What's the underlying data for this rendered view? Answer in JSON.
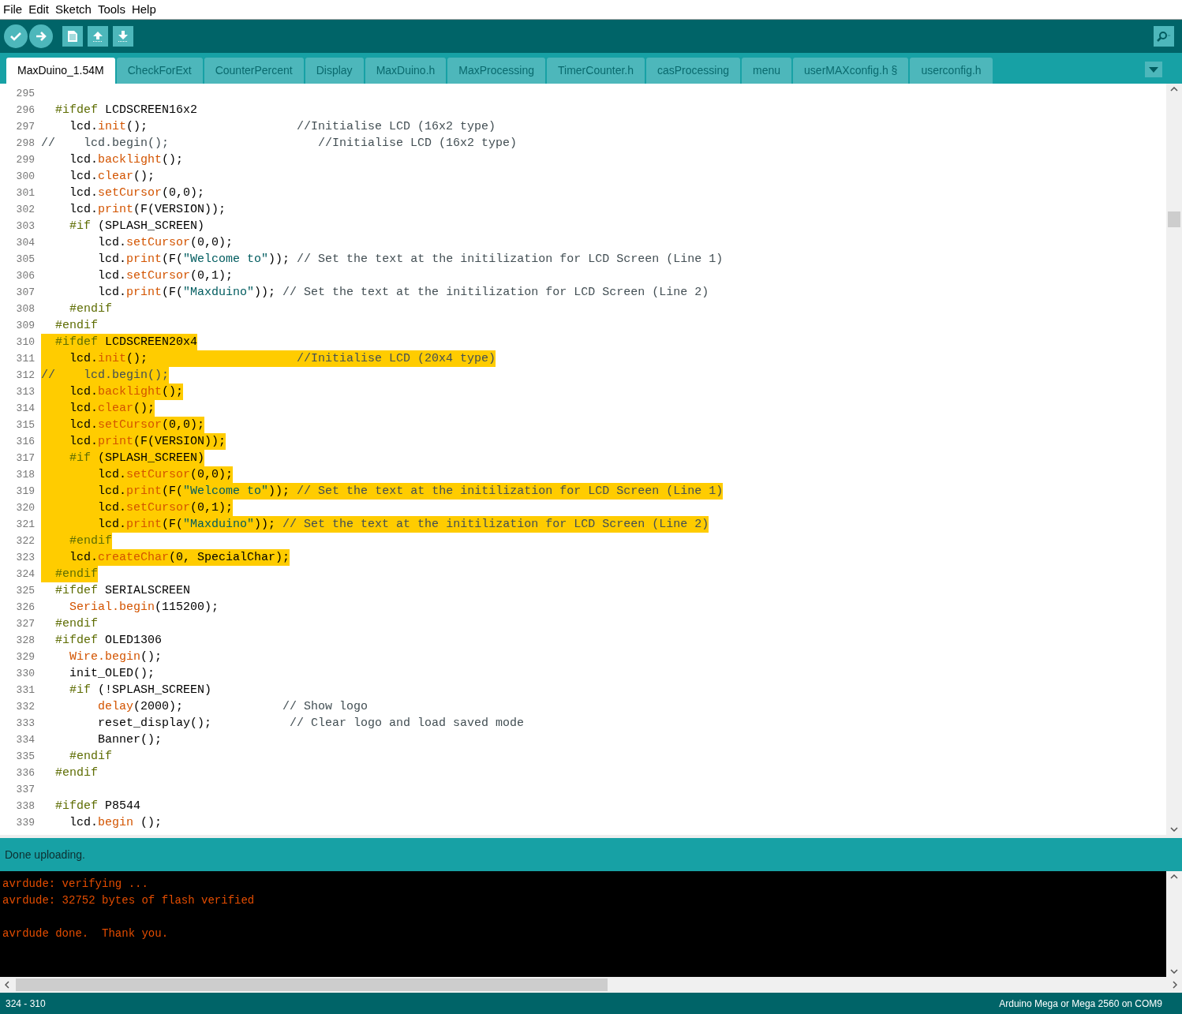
{
  "menu": [
    "File",
    "Edit",
    "Sketch",
    "Tools",
    "Help"
  ],
  "tabs": [
    {
      "label": "MaxDuino_1.54M",
      "selected": true
    },
    {
      "label": "CheckForExt",
      "selected": false
    },
    {
      "label": "CounterPercent",
      "selected": false
    },
    {
      "label": "Display",
      "selected": false
    },
    {
      "label": "MaxDuino.h",
      "selected": false
    },
    {
      "label": "MaxProcessing",
      "selected": false
    },
    {
      "label": "TimerCounter.h",
      "selected": false
    },
    {
      "label": "casProcessing",
      "selected": false
    },
    {
      "label": "menu",
      "selected": false
    },
    {
      "label": "userMAXconfig.h §",
      "selected": false
    },
    {
      "label": "userconfig.h",
      "selected": false
    }
  ],
  "editor": {
    "lines": [
      {
        "number": "295",
        "selected": false
      },
      {
        "number": "296",
        "selected": false,
        "tokens": [
          {
            "kind": "directive",
            "text": "  #ifdef"
          },
          {
            "kind": "plain",
            "text": " LCDSCREEN16x2"
          }
        ]
      },
      {
        "number": "297",
        "selected": false,
        "tokens": [
          {
            "kind": "plain",
            "text": "    lcd."
          },
          {
            "kind": "function",
            "text": "init"
          },
          {
            "kind": "plain",
            "text": "();"
          },
          {
            "kind": "comment",
            "text": "                     //Initialise LCD (16x2 type)"
          }
        ]
      },
      {
        "number": "298",
        "selected": false,
        "tokens": [
          {
            "kind": "comment",
            "text": "//    lcd.begin();                     //Initialise LCD (16x2 type)"
          }
        ]
      },
      {
        "number": "299",
        "selected": false,
        "tokens": [
          {
            "kind": "plain",
            "text": "    lcd."
          },
          {
            "kind": "function",
            "text": "backlight"
          },
          {
            "kind": "plain",
            "text": "();"
          }
        ]
      },
      {
        "number": "300",
        "selected": false,
        "tokens": [
          {
            "kind": "plain",
            "text": "    lcd."
          },
          {
            "kind": "function",
            "text": "clear"
          },
          {
            "kind": "plain",
            "text": "();"
          }
        ]
      },
      {
        "number": "301",
        "selected": false,
        "tokens": [
          {
            "kind": "plain",
            "text": "    lcd."
          },
          {
            "kind": "function",
            "text": "setCursor"
          },
          {
            "kind": "plain",
            "text": "(0,0);"
          }
        ]
      },
      {
        "number": "302",
        "selected": false,
        "tokens": [
          {
            "kind": "plain",
            "text": "    lcd."
          },
          {
            "kind": "function",
            "text": "print"
          },
          {
            "kind": "plain",
            "text": "(F(VERSION));"
          }
        ]
      },
      {
        "number": "303",
        "selected": false,
        "tokens": [
          {
            "kind": "directive",
            "text": "    #if"
          },
          {
            "kind": "plain",
            "text": " (SPLASH_SCREEN)"
          }
        ]
      },
      {
        "number": "304",
        "selected": false,
        "tokens": [
          {
            "kind": "plain",
            "text": "        lcd."
          },
          {
            "kind": "function",
            "text": "setCursor"
          },
          {
            "kind": "plain",
            "text": "(0,0);"
          }
        ]
      },
      {
        "number": "305",
        "selected": false,
        "tokens": [
          {
            "kind": "plain",
            "text": "        lcd."
          },
          {
            "kind": "function",
            "text": "print"
          },
          {
            "kind": "plain",
            "text": "(F("
          },
          {
            "kind": "string",
            "text": "\"Welcome to\""
          },
          {
            "kind": "plain",
            "text": ")); "
          },
          {
            "kind": "comment",
            "text": "// Set the text at the initilization for LCD Screen (Line 1)"
          }
        ]
      },
      {
        "number": "306",
        "selected": false,
        "tokens": [
          {
            "kind": "plain",
            "text": "        lcd."
          },
          {
            "kind": "function",
            "text": "setCursor"
          },
          {
            "kind": "plain",
            "text": "(0,1);"
          }
        ]
      },
      {
        "number": "307",
        "selected": false,
        "tokens": [
          {
            "kind": "plain",
            "text": "        lcd."
          },
          {
            "kind": "function",
            "text": "print"
          },
          {
            "kind": "plain",
            "text": "(F("
          },
          {
            "kind": "string",
            "text": "\"Maxduino\""
          },
          {
            "kind": "plain",
            "text": ")); "
          },
          {
            "kind": "comment",
            "text": "// Set the text at the initilization for LCD Screen (Line 2)"
          }
        ]
      },
      {
        "number": "308",
        "selected": false,
        "tokens": [
          {
            "kind": "directive",
            "text": "    #endif"
          }
        ]
      },
      {
        "number": "309",
        "selected": false,
        "tokens": [
          {
            "kind": "directive",
            "text": "  #endif"
          }
        ]
      },
      {
        "number": "310",
        "selected": true,
        "tokens": [
          {
            "kind": "directive",
            "text": "  #ifdef"
          },
          {
            "kind": "plain",
            "text": " LCDSCREEN20x4"
          }
        ]
      },
      {
        "number": "311",
        "selected": true,
        "tokens": [
          {
            "kind": "plain",
            "text": "    lcd."
          },
          {
            "kind": "function",
            "text": "init"
          },
          {
            "kind": "plain",
            "text": "();"
          },
          {
            "kind": "comment",
            "text": "                     //Initialise LCD (20x4 type)"
          }
        ]
      },
      {
        "number": "312",
        "selected": true,
        "tokens": [
          {
            "kind": "comment",
            "text": "//    lcd.begin();"
          }
        ]
      },
      {
        "number": "313",
        "selected": true,
        "tokens": [
          {
            "kind": "plain",
            "text": "    lcd."
          },
          {
            "kind": "function",
            "text": "backlight"
          },
          {
            "kind": "plain",
            "text": "();"
          }
        ]
      },
      {
        "number": "314",
        "selected": true,
        "tokens": [
          {
            "kind": "plain",
            "text": "    lcd."
          },
          {
            "kind": "function",
            "text": "clear"
          },
          {
            "kind": "plain",
            "text": "();"
          }
        ]
      },
      {
        "number": "315",
        "selected": true,
        "tokens": [
          {
            "kind": "plain",
            "text": "    lcd."
          },
          {
            "kind": "function",
            "text": "setCursor"
          },
          {
            "kind": "plain",
            "text": "(0,0);"
          }
        ]
      },
      {
        "number": "316",
        "selected": true,
        "tokens": [
          {
            "kind": "plain",
            "text": "    lcd."
          },
          {
            "kind": "function",
            "text": "print"
          },
          {
            "kind": "plain",
            "text": "(F(VERSION));"
          }
        ]
      },
      {
        "number": "317",
        "selected": true,
        "tokens": [
          {
            "kind": "directive",
            "text": "    #if"
          },
          {
            "kind": "plain",
            "text": " (SPLASH_SCREEN)"
          }
        ]
      },
      {
        "number": "318",
        "selected": true,
        "tokens": [
          {
            "kind": "plain",
            "text": "        lcd."
          },
          {
            "kind": "function",
            "text": "setCursor"
          },
          {
            "kind": "plain",
            "text": "(0,0);"
          }
        ]
      },
      {
        "number": "319",
        "selected": true,
        "tokens": [
          {
            "kind": "plain",
            "text": "        lcd."
          },
          {
            "kind": "function",
            "text": "print"
          },
          {
            "kind": "plain",
            "text": "(F("
          },
          {
            "kind": "string",
            "text": "\"Welcome to\""
          },
          {
            "kind": "plain",
            "text": ")); "
          },
          {
            "kind": "comment",
            "text": "// Set the text at the initilization for LCD Screen (Line 1)"
          }
        ]
      },
      {
        "number": "320",
        "selected": true,
        "tokens": [
          {
            "kind": "plain",
            "text": "        lcd."
          },
          {
            "kind": "function",
            "text": "setCursor"
          },
          {
            "kind": "plain",
            "text": "(0,1);"
          }
        ]
      },
      {
        "number": "321",
        "selected": true,
        "tokens": [
          {
            "kind": "plain",
            "text": "        lcd."
          },
          {
            "kind": "function",
            "text": "print"
          },
          {
            "kind": "plain",
            "text": "(F("
          },
          {
            "kind": "string",
            "text": "\"Maxduino\""
          },
          {
            "kind": "plain",
            "text": ")); "
          },
          {
            "kind": "comment",
            "text": "// Set the text at the initilization for LCD Screen (Line 2)"
          }
        ]
      },
      {
        "number": "322",
        "selected": true,
        "tokens": [
          {
            "kind": "directive",
            "text": "    #endif"
          }
        ]
      },
      {
        "number": "323",
        "selected": true,
        "tokens": [
          {
            "kind": "plain",
            "text": "    lcd."
          },
          {
            "kind": "function",
            "text": "createChar"
          },
          {
            "kind": "plain",
            "text": "(0, SpecialChar);"
          }
        ]
      },
      {
        "number": "324",
        "selected": true,
        "tokens": [
          {
            "kind": "directive",
            "text": "  #endif"
          }
        ]
      },
      {
        "number": "325",
        "selected": false,
        "tokens": [
          {
            "kind": "directive",
            "text": "  #ifdef"
          },
          {
            "kind": "plain",
            "text": " SERIALSCREEN"
          }
        ]
      },
      {
        "number": "326",
        "selected": false,
        "tokens": [
          {
            "kind": "function",
            "text": "    Serial.begin"
          },
          {
            "kind": "plain",
            "text": "(115200);"
          }
        ]
      },
      {
        "number": "327",
        "selected": false,
        "tokens": [
          {
            "kind": "directive",
            "text": "  #endif"
          }
        ]
      },
      {
        "number": "328",
        "selected": false,
        "tokens": [
          {
            "kind": "directive",
            "text": "  #ifdef"
          },
          {
            "kind": "plain",
            "text": " OLED1306"
          }
        ]
      },
      {
        "number": "329",
        "selected": false,
        "tokens": [
          {
            "kind": "function",
            "text": "    Wire.begin"
          },
          {
            "kind": "plain",
            "text": "();"
          }
        ]
      },
      {
        "number": "330",
        "selected": false,
        "tokens": [
          {
            "kind": "plain",
            "text": "    init_OLED();"
          }
        ]
      },
      {
        "number": "331",
        "selected": false,
        "tokens": [
          {
            "kind": "directive",
            "text": "    #if"
          },
          {
            "kind": "plain",
            "text": " (!SPLASH_SCREEN)"
          }
        ]
      },
      {
        "number": "332",
        "selected": false,
        "tokens": [
          {
            "kind": "function",
            "text": "        delay"
          },
          {
            "kind": "plain",
            "text": "(2000);"
          },
          {
            "kind": "comment",
            "text": "              // Show logo"
          }
        ]
      },
      {
        "number": "333",
        "selected": false,
        "tokens": [
          {
            "kind": "plain",
            "text": "        reset_display();"
          },
          {
            "kind": "comment",
            "text": "           // Clear logo and load saved mode"
          }
        ]
      },
      {
        "number": "334",
        "selected": false,
        "tokens": [
          {
            "kind": "plain",
            "text": "        Banner();"
          }
        ]
      },
      {
        "number": "335",
        "selected": false,
        "tokens": [
          {
            "kind": "directive",
            "text": "    #endif"
          }
        ]
      },
      {
        "number": "336",
        "selected": false,
        "tokens": [
          {
            "kind": "directive",
            "text": "  #endif"
          }
        ]
      },
      {
        "number": "337",
        "selected": false
      },
      {
        "number": "338",
        "selected": false,
        "tokens": [
          {
            "kind": "directive",
            "text": "  #ifdef"
          },
          {
            "kind": "plain",
            "text": " P8544"
          }
        ]
      },
      {
        "number": "339",
        "selected": false,
        "tokens": [
          {
            "kind": "plain",
            "text": "    lcd."
          },
          {
            "kind": "function",
            "text": "begin"
          },
          {
            "kind": "plain",
            "text": " ();"
          }
        ]
      }
    ]
  },
  "message": "Done uploading.",
  "console": [
    [
      "avrdude: verifying ...",
      "avrdude: 32752 bytes of flash verified"
    ],
    [
      "avrdude done.  Thank you."
    ]
  ],
  "status_bar": {
    "position": "324 - 310",
    "board": "Arduino Mega or Mega 2560 on COM9"
  }
}
